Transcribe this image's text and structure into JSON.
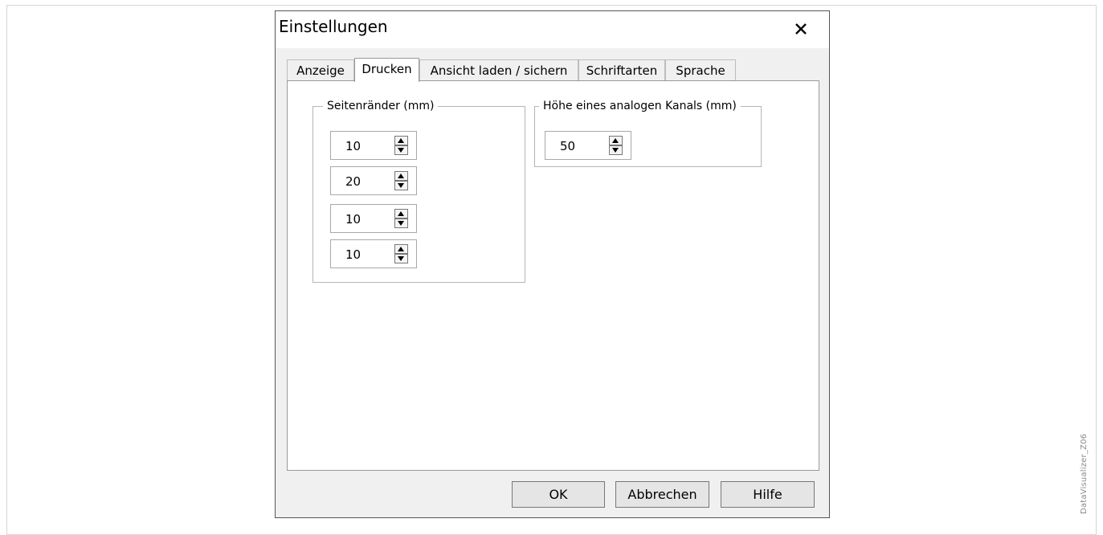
{
  "watermark": "DataVisualizer_Z06",
  "dialog": {
    "title": "Einstellungen",
    "close_icon": "close-icon"
  },
  "tabs": [
    {
      "label": "Anzeige",
      "active": false
    },
    {
      "label": "Drucken",
      "active": true
    },
    {
      "label": "Ansicht laden / sichern",
      "active": false
    },
    {
      "label": "Schriftarten",
      "active": false
    },
    {
      "label": "Sprache",
      "active": false
    }
  ],
  "margins_group": {
    "label": "Seitenränder (mm)",
    "values": [
      "10",
      "20",
      "10",
      "10"
    ]
  },
  "channel_group": {
    "label": "Höhe eines analogen Kanals (mm)",
    "value": "50"
  },
  "buttons": {
    "ok": "OK",
    "cancel": "Abbrechen",
    "help": "Hilfe"
  }
}
